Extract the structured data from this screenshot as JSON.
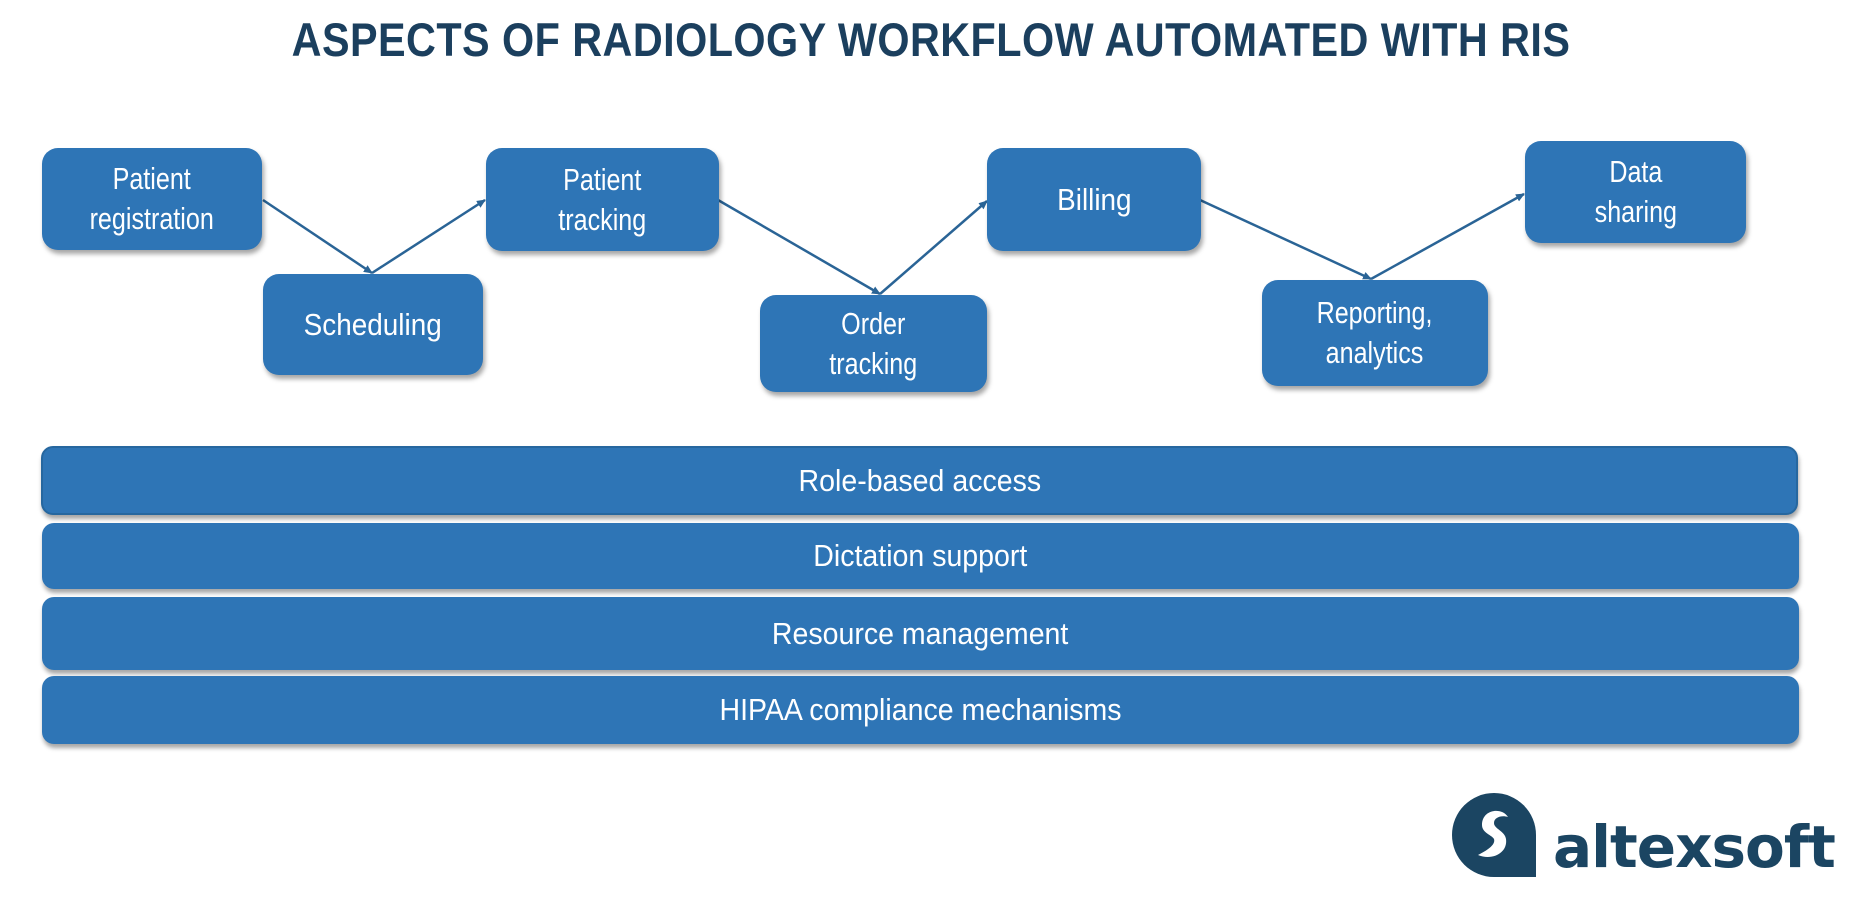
{
  "title": "ASPECTS OF RADIOLOGY WORKFLOW AUTOMATED WITH RIS",
  "colors": {
    "box_fill": "#2e75b6",
    "box_text": "#ffffff",
    "arrow": "#2a6496",
    "title": "#1b3f5e",
    "logo": "#1b4562"
  },
  "workflow_steps": [
    {
      "label": "Patient registration",
      "lines": [
        "Patient",
        "registration"
      ],
      "row": "top"
    },
    {
      "label": "Scheduling",
      "lines": [
        "Scheduling"
      ],
      "row": "bottom"
    },
    {
      "label": "Patient tracking",
      "lines": [
        "Patient",
        "tracking"
      ],
      "row": "top"
    },
    {
      "label": "Order tracking",
      "lines": [
        "Order",
        "tracking"
      ],
      "row": "bottom"
    },
    {
      "label": "Billing",
      "lines": [
        "Billing"
      ],
      "row": "top"
    },
    {
      "label": "Reporting, analytics",
      "lines": [
        "Reporting,",
        "analytics"
      ],
      "row": "bottom"
    },
    {
      "label": "Data sharing",
      "lines": [
        "Data",
        "sharing"
      ],
      "row": "top"
    }
  ],
  "flow": [
    {
      "from": "Patient registration",
      "to": "Scheduling"
    },
    {
      "from": "Scheduling",
      "to": "Patient tracking"
    },
    {
      "from": "Patient tracking",
      "to": "Order tracking"
    },
    {
      "from": "Order tracking",
      "to": "Billing"
    },
    {
      "from": "Billing",
      "to": "Reporting, analytics"
    },
    {
      "from": "Reporting, analytics",
      "to": "Data sharing"
    }
  ],
  "cross_cutting_features": [
    "Role-based access",
    "Dictation support",
    "Resource management",
    "HIPAA compliance mechanisms"
  ],
  "logo": {
    "icon": "altexsoft-logo-icon",
    "text": "altexsoft"
  }
}
